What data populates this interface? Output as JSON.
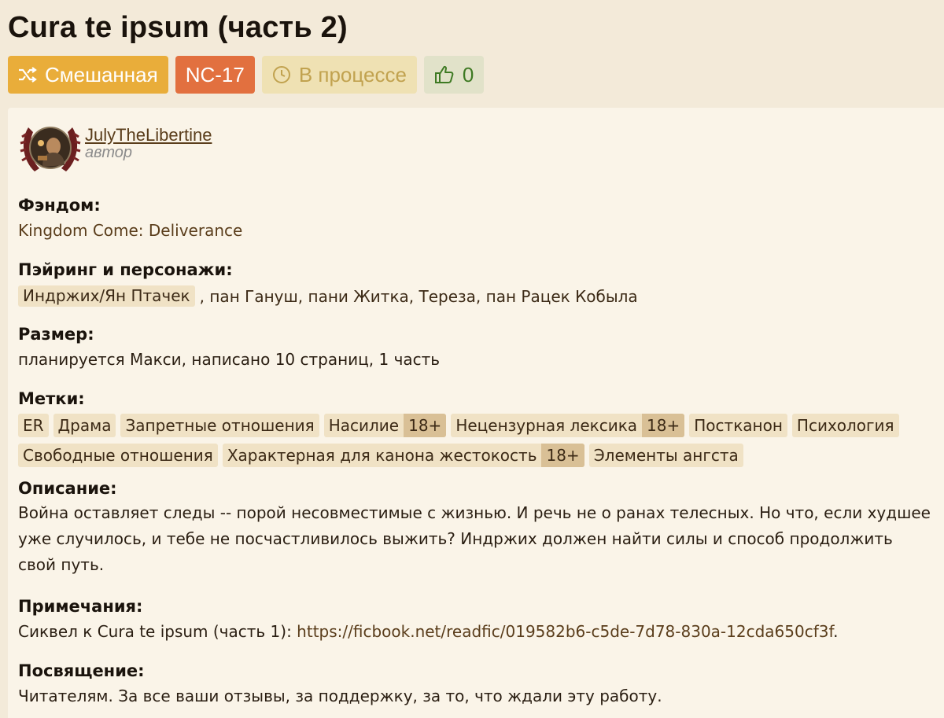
{
  "title": "Cura te ipsum (часть 2)",
  "badges": {
    "direction": "Смешанная",
    "rating": "NC-17",
    "status": "В процессе",
    "likes": "0"
  },
  "author": {
    "name": "JulyTheLibertine",
    "role": "автор"
  },
  "fandom": {
    "label": "Фэндом:",
    "value": "Kingdom Come: Deliverance"
  },
  "pairing": {
    "label": "Пэйринг и персонажи:",
    "main": "Индржих/Ян Птачек",
    "rest": ", пан Гануш, пани Житка, Тереза, пан Рацек Кобыла"
  },
  "size": {
    "label": "Размер:",
    "value": "планируется Макси, написано 10 страниц, 1 часть"
  },
  "tags": {
    "label": "Метки:",
    "items": [
      {
        "text": "ER",
        "age": ""
      },
      {
        "text": "Драма",
        "age": ""
      },
      {
        "text": "Запретные отношения",
        "age": ""
      },
      {
        "text": "Насилие",
        "age": "18+"
      },
      {
        "text": "Нецензурная лексика",
        "age": "18+"
      },
      {
        "text": "Постканон",
        "age": ""
      },
      {
        "text": "Психология",
        "age": ""
      },
      {
        "text": "Свободные отношения",
        "age": ""
      },
      {
        "text": "Характерная для канона жестокость",
        "age": "18+"
      },
      {
        "text": "Элементы ангста",
        "age": ""
      }
    ]
  },
  "description": {
    "label": "Описание:",
    "text": "Война оставляет следы -- порой несовместимые с жизнью. И речь не о ранах телесных. Но что, если худшее уже случилось, и тебе не посчастливилось выжить? Индржих должен найти силы и способ продолжить свой путь."
  },
  "notes": {
    "label": "Примечания:",
    "prefix": "Сиквел к Cura te ipsum (часть 1): ",
    "link": "https://ficbook.net/readfic/019582b6-c5de-7d78-830a-12cda650cf3f",
    "suffix": "."
  },
  "dedication": {
    "label": "Посвящение:",
    "text": "Читателям. За все ваши отзывы, за поддержку, за то, что ждали эту работу."
  },
  "colors": {
    "background": "#f3ead9",
    "card": "#faf4e8",
    "mixed": "#e9ad3a",
    "rating": "#e2703f",
    "status": "#efe1b3",
    "likes": "#e1e2c9",
    "chip": "#f0e2c5",
    "age_chip": "#d9c096"
  },
  "icons": {
    "direction": "shuffle-icon",
    "status": "clock-icon",
    "likes": "thumbs-up-icon"
  }
}
